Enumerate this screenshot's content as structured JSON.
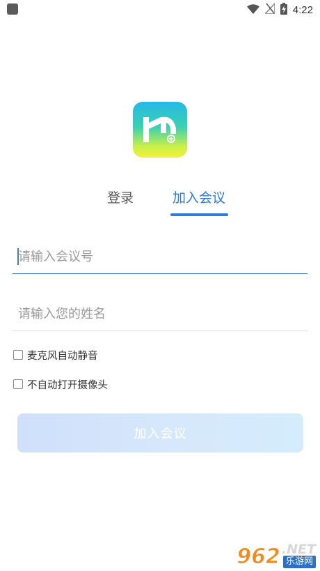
{
  "status_bar": {
    "time": "4:22",
    "icons": [
      "notification-icon",
      "wifi-icon",
      "no-signal-icon",
      "battery-charging-icon"
    ]
  },
  "app": {
    "logo_icon": "app-logo-icon",
    "accent_color": "#2f7bd9"
  },
  "tabs": [
    {
      "label": "登录",
      "active": false
    },
    {
      "label": "加入会议",
      "active": true
    }
  ],
  "form": {
    "meeting_id": {
      "placeholder": "请输入会议号",
      "value": ""
    },
    "name": {
      "placeholder": "请输入您的姓名",
      "value": ""
    }
  },
  "options": [
    {
      "label": "麦克风自动静音",
      "checked": false
    },
    {
      "label": "不自动打开摄像头",
      "checked": false
    }
  ],
  "join_button": {
    "label": "加入会议"
  },
  "watermark": {
    "number": "962",
    "net": ".NET",
    "site": "乐游网"
  }
}
